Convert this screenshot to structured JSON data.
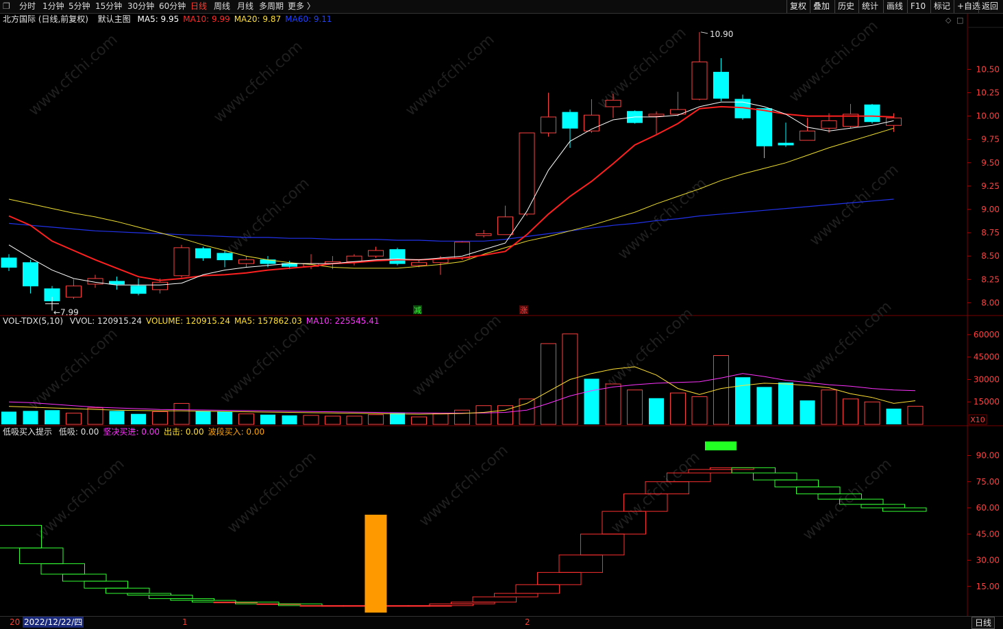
{
  "toolbar": {
    "left_icon": "window-restore-icon",
    "periods": [
      "分时",
      "1分钟",
      "5分钟",
      "15分钟",
      "30分钟",
      "60分钟",
      "日线",
      "周线",
      "月线",
      "多周期",
      "更多 〉"
    ],
    "active_period": "日线",
    "right_buttons": [
      "复权",
      "叠加",
      "历史",
      "统计",
      "画线",
      "F10",
      "标记",
      "+自选",
      "返回"
    ]
  },
  "main_panel": {
    "title": "北方国际 (日线,前复权)",
    "template": "默认主图",
    "ma_values": [
      {
        "label": "MA5: 9.95",
        "color": "#ffffff"
      },
      {
        "label": "MA10: 9.99",
        "color": "#ff2a2a"
      },
      {
        "label": "MA20: 9.87",
        "color": "#ffe033"
      },
      {
        "label": "MA60: 9.11",
        "color": "#1f3fff"
      }
    ],
    "y_ticks": [
      "10.50",
      "10.25",
      "10.00",
      "9.75",
      "9.50",
      "9.25",
      "9.00",
      "8.75",
      "8.50",
      "8.25",
      "8.00"
    ],
    "high_label": "10.90",
    "low_label": "7.99",
    "marker_green": "减",
    "marker_red": "涨"
  },
  "volume_panel": {
    "title": "VOL-TDX(5,10)",
    "items": [
      {
        "label": "VVOL: 120915.24",
        "color": "#e0e0e0"
      },
      {
        "label": "VOLUME: 120915.24",
        "color": "#ffe033"
      },
      {
        "label": "MA5: 157862.03",
        "color": "#ffe033"
      },
      {
        "label": "MA10: 225545.41",
        "color": "#ff33ff"
      }
    ],
    "y_ticks": [
      "60000",
      "45000",
      "30000",
      "15000"
    ],
    "unit_label": "X10"
  },
  "indicator_panel": {
    "title": "低吸买入提示",
    "items": [
      {
        "label": "低吸: 0.00",
        "color": "#e0e0e0"
      },
      {
        "label": "坚决买进: 0.00",
        "color": "#ff33ff"
      },
      {
        "label": "出击: 0.00",
        "color": "#ffe033"
      },
      {
        "label": "波段买入: 0.00",
        "color": "#ffa500"
      }
    ],
    "y_ticks": [
      "90.00",
      "75.00",
      "60.00",
      "45.00",
      "30.00",
      "15.00"
    ]
  },
  "bottom_bar": {
    "year_prefix": "20",
    "date": "2022/12/22/四",
    "month_marks": [
      "1",
      "2"
    ],
    "period_label": "日线"
  },
  "watermark": "www.cfchi.com",
  "chart_data": [
    {
      "type": "candlestick",
      "title": "北方国际 (日线,前复权)",
      "ylim": [
        7.9,
        10.95
      ],
      "candles": [
        {
          "o": 8.38,
          "c": 8.48,
          "h": 8.52,
          "l": 8.34,
          "up": false
        },
        {
          "o": 8.43,
          "c": 8.18,
          "h": 8.46,
          "l": 8.1,
          "up": false
        },
        {
          "o": 8.15,
          "c": 8.02,
          "h": 8.18,
          "l": 7.99,
          "up": false
        },
        {
          "o": 8.06,
          "c": 8.18,
          "h": 8.25,
          "l": 8.04,
          "up": true
        },
        {
          "o": 8.2,
          "c": 8.26,
          "h": 8.3,
          "l": 8.16,
          "up": true
        },
        {
          "o": 8.23,
          "c": 8.2,
          "h": 8.28,
          "l": 8.14,
          "up": false
        },
        {
          "o": 8.18,
          "c": 8.1,
          "h": 8.26,
          "l": 8.08,
          "up": false
        },
        {
          "o": 8.14,
          "c": 8.22,
          "h": 8.26,
          "l": 8.1,
          "up": true
        },
        {
          "o": 8.29,
          "c": 8.59,
          "h": 8.62,
          "l": 8.27,
          "up": true
        },
        {
          "o": 8.58,
          "c": 8.48,
          "h": 8.6,
          "l": 8.45,
          "up": false
        },
        {
          "o": 8.53,
          "c": 8.46,
          "h": 8.56,
          "l": 8.38,
          "up": false
        },
        {
          "o": 8.42,
          "c": 8.46,
          "h": 8.5,
          "l": 8.38,
          "up": true
        },
        {
          "o": 8.46,
          "c": 8.42,
          "h": 8.5,
          "l": 8.38,
          "up": false
        },
        {
          "o": 8.42,
          "c": 8.39,
          "h": 8.45,
          "l": 8.36,
          "up": false
        },
        {
          "o": 8.39,
          "c": 8.42,
          "h": 8.52,
          "l": 8.36,
          "up": true
        },
        {
          "o": 8.42,
          "c": 8.44,
          "h": 8.5,
          "l": 8.36,
          "up": true
        },
        {
          "o": 8.44,
          "c": 8.5,
          "h": 8.52,
          "l": 8.4,
          "up": true
        },
        {
          "o": 8.5,
          "c": 8.56,
          "h": 8.6,
          "l": 8.48,
          "up": true
        },
        {
          "o": 8.57,
          "c": 8.42,
          "h": 8.59,
          "l": 8.4,
          "up": false
        },
        {
          "o": 8.4,
          "c": 8.43,
          "h": 8.46,
          "l": 8.38,
          "up": true
        },
        {
          "o": 8.43,
          "c": 8.47,
          "h": 8.5,
          "l": 8.3,
          "up": true
        },
        {
          "o": 8.48,
          "c": 8.65,
          "h": 8.66,
          "l": 8.46,
          "up": true
        },
        {
          "o": 8.72,
          "c": 8.74,
          "h": 8.78,
          "l": 8.7,
          "up": true
        },
        {
          "o": 8.73,
          "c": 8.92,
          "h": 9.04,
          "l": 8.73,
          "up": true
        },
        {
          "o": 8.95,
          "c": 9.82,
          "h": 9.82,
          "l": 8.93,
          "up": true
        },
        {
          "o": 9.82,
          "c": 9.99,
          "h": 10.25,
          "l": 9.78,
          "up": true
        },
        {
          "o": 10.04,
          "c": 9.87,
          "h": 10.07,
          "l": 9.66,
          "up": false
        },
        {
          "o": 9.84,
          "c": 10.01,
          "h": 10.18,
          "l": 9.82,
          "up": true
        },
        {
          "o": 10.1,
          "c": 10.17,
          "h": 10.24,
          "l": 9.98,
          "up": true
        },
        {
          "o": 10.05,
          "c": 9.93,
          "h": 10.06,
          "l": 9.92,
          "up": false
        },
        {
          "o": 10.0,
          "c": 10.02,
          "h": 10.05,
          "l": 9.81,
          "up": true
        },
        {
          "o": 10.02,
          "c": 10.07,
          "h": 10.26,
          "l": 10.0,
          "up": true
        },
        {
          "o": 10.18,
          "c": 10.58,
          "h": 10.9,
          "l": 10.17,
          "up": true
        },
        {
          "o": 10.47,
          "c": 10.19,
          "h": 10.62,
          "l": 10.16,
          "up": false
        },
        {
          "o": 10.18,
          "c": 9.98,
          "h": 10.23,
          "l": 9.96,
          "up": false
        },
        {
          "o": 10.08,
          "c": 9.68,
          "h": 10.08,
          "l": 9.55,
          "up": false
        },
        {
          "o": 9.71,
          "c": 9.69,
          "h": 9.93,
          "l": 9.67,
          "up": false
        },
        {
          "o": 9.74,
          "c": 9.84,
          "h": 9.98,
          "l": 9.74,
          "up": true
        },
        {
          "o": 9.87,
          "c": 9.95,
          "h": 10.03,
          "l": 9.82,
          "up": true
        },
        {
          "o": 9.89,
          "c": 10.02,
          "h": 10.13,
          "l": 9.87,
          "up": true
        },
        {
          "o": 10.12,
          "c": 9.94,
          "h": 10.13,
          "l": 9.92,
          "up": false
        },
        {
          "o": 9.9,
          "c": 9.98,
          "h": 10.03,
          "l": 9.83,
          "up": true
        }
      ],
      "ma5": [
        8.62,
        8.48,
        8.35,
        8.26,
        8.22,
        8.19,
        8.19,
        8.19,
        8.21,
        8.3,
        8.35,
        8.38,
        8.4,
        8.42,
        8.42,
        8.42,
        8.44,
        8.46,
        8.47,
        8.46,
        8.48,
        8.5,
        8.57,
        8.64,
        8.98,
        9.42,
        9.73,
        9.86,
        9.96,
        9.99,
        9.99,
        10.01,
        10.1,
        10.15,
        10.15,
        10.1,
        10.02,
        9.88,
        9.84,
        9.87,
        9.9,
        9.95
      ],
      "ma10": [
        8.93,
        8.83,
        8.66,
        8.56,
        8.46,
        8.37,
        8.28,
        8.24,
        8.26,
        8.29,
        8.3,
        8.32,
        8.35,
        8.37,
        8.39,
        8.42,
        8.43,
        8.45,
        8.46,
        8.46,
        8.47,
        8.48,
        8.51,
        8.55,
        8.73,
        8.95,
        9.14,
        9.3,
        9.49,
        9.69,
        9.8,
        9.92,
        10.08,
        10.1,
        10.09,
        10.06,
        10.02,
        10.0,
        10.0,
        10.0,
        10.0,
        9.99
      ],
      "ma20": [
        9.11,
        9.06,
        9.01,
        8.96,
        8.92,
        8.87,
        8.81,
        8.75,
        8.69,
        8.62,
        8.56,
        8.5,
        8.46,
        8.43,
        8.41,
        8.38,
        8.37,
        8.37,
        8.37,
        8.39,
        8.41,
        8.44,
        8.52,
        8.59,
        8.66,
        8.71,
        8.77,
        8.83,
        8.9,
        8.97,
        9.06,
        9.14,
        9.22,
        9.31,
        9.38,
        9.44,
        9.5,
        9.58,
        9.66,
        9.73,
        9.8,
        9.87
      ],
      "ma60": [
        8.85,
        8.83,
        8.81,
        8.79,
        8.77,
        8.76,
        8.75,
        8.74,
        8.73,
        8.72,
        8.71,
        8.7,
        8.7,
        8.69,
        8.69,
        8.68,
        8.68,
        8.68,
        8.67,
        8.67,
        8.66,
        8.66,
        8.66,
        8.68,
        8.71,
        8.74,
        8.77,
        8.8,
        8.83,
        8.85,
        8.88,
        8.9,
        8.93,
        8.95,
        8.97,
        8.99,
        9.01,
        9.03,
        9.05,
        9.07,
        9.09,
        9.11
      ]
    },
    {
      "type": "bar",
      "title": "VOL-TDX(5,10)",
      "ylim": [
        0,
        65000
      ],
      "volume": [
        8500,
        9000,
        9500,
        7500,
        11000,
        9000,
        7000,
        8500,
        14000,
        9000,
        8500,
        7000,
        6500,
        6000,
        6000,
        5500,
        5500,
        6500,
        7500,
        5000,
        7000,
        9500,
        12500,
        12500,
        17000,
        54000,
        60500,
        30500,
        27000,
        23000,
        17500,
        21000,
        18500,
        46000,
        31500,
        25000,
        28000,
        16000,
        23000,
        17000,
        15000,
        10500,
        12091
      ],
      "volume_up": [
        false,
        false,
        false,
        true,
        true,
        false,
        false,
        true,
        true,
        false,
        false,
        true,
        false,
        false,
        true,
        true,
        true,
        true,
        false,
        true,
        true,
        true,
        true,
        true,
        true,
        true,
        true,
        false,
        true,
        true,
        false,
        true,
        true,
        true,
        false,
        false,
        false,
        false,
        true,
        true,
        true,
        false,
        true
      ],
      "vol_ma5": [
        12000,
        11500,
        11000,
        10500,
        10000,
        9500,
        9300,
        9000,
        9000,
        8800,
        8600,
        8400,
        8200,
        8000,
        7800,
        7600,
        7400,
        7200,
        7000,
        6800,
        7000,
        7300,
        8000,
        9500,
        14000,
        22000,
        30000,
        34000,
        37000,
        38500,
        33000,
        24000,
        20000,
        24000,
        26000,
        27500,
        27000,
        26000,
        24500,
        20500,
        18000,
        14000,
        15786
      ],
      "vol_ma10": [
        15000,
        14500,
        13500,
        12500,
        11500,
        11000,
        10500,
        10000,
        9800,
        9600,
        9400,
        9200,
        9000,
        8800,
        8600,
        8400,
        8200,
        8000,
        7800,
        7600,
        7500,
        7500,
        7600,
        8000,
        9500,
        14000,
        19000,
        22500,
        25000,
        26500,
        27500,
        28000,
        28500,
        31000,
        34000,
        32000,
        29500,
        28000,
        26500,
        25500,
        24000,
        23000,
        22554
      ]
    },
    {
      "type": "step",
      "title": "低吸买入提示",
      "ylim": [
        0,
        100
      ],
      "values": [
        50,
        37,
        28,
        22,
        18,
        14,
        11,
        10,
        8,
        7,
        6,
        6,
        5,
        5,
        4,
        4,
        4,
        4,
        4,
        4,
        4,
        5,
        6,
        9,
        11,
        16,
        23,
        33,
        45,
        58,
        68,
        75,
        80,
        82,
        83,
        80,
        76,
        72,
        68,
        65,
        62,
        60,
        58
      ],
      "buy_signal_index": 17,
      "sell_signal_index": 32
    }
  ]
}
